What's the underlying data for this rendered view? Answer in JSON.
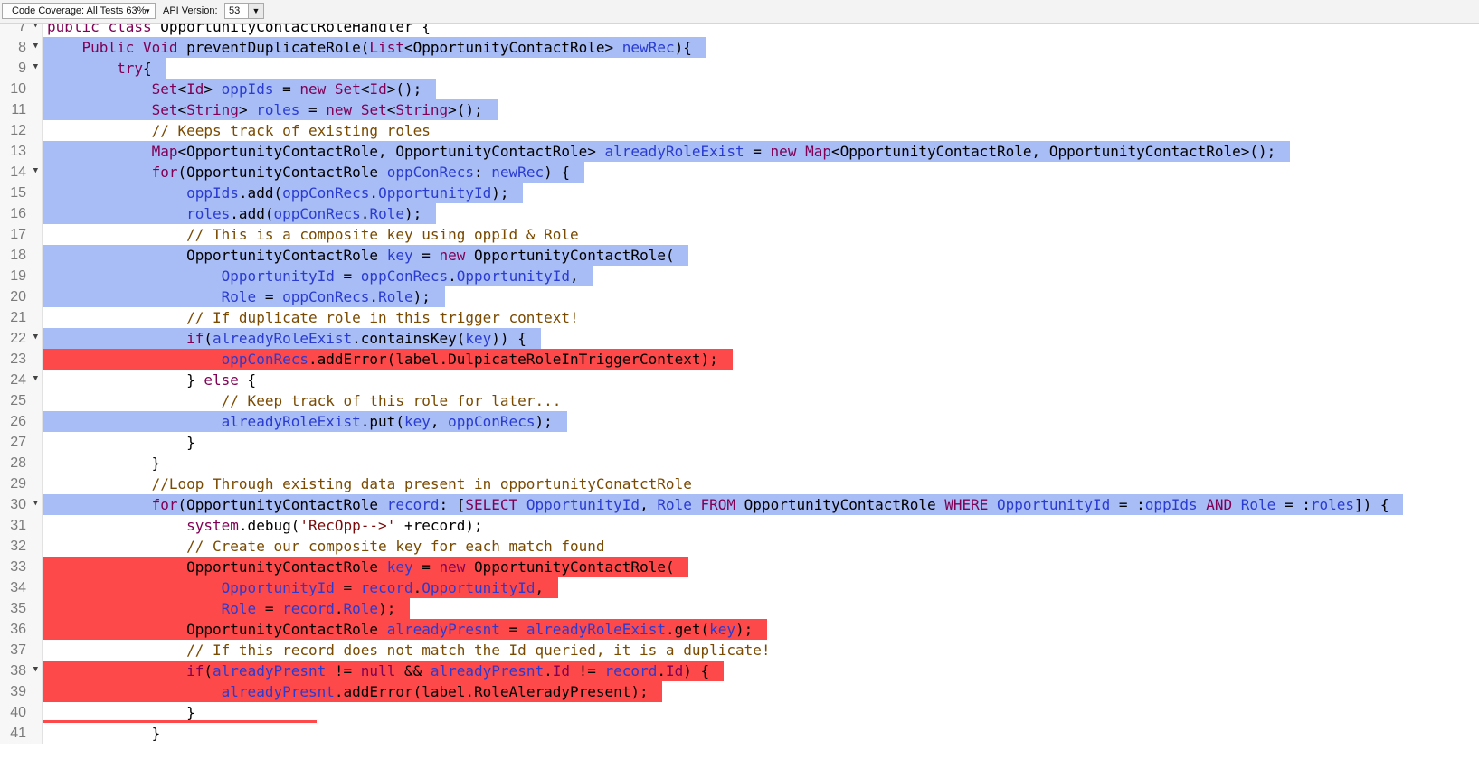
{
  "toolbar": {
    "coverage_label": "Code Coverage: All Tests 63%",
    "api_version_label": "API Version:",
    "api_version_value": "53"
  },
  "colors": {
    "covered": "#a8bcf5",
    "uncovered": "#fd4949"
  },
  "lines": [
    {
      "n": "7",
      "fold": true,
      "cov": "none",
      "text": "public class OpportunityContactRoleHandler {"
    },
    {
      "n": "8",
      "fold": true,
      "cov": "covered",
      "text": "    Public Void preventDuplicateRole(List<OpportunityContactRole> newRec){"
    },
    {
      "n": "9",
      "fold": true,
      "cov": "covered",
      "text": "        try{"
    },
    {
      "n": "10",
      "fold": false,
      "cov": "covered",
      "text": "            Set<Id> oppIds = new Set<Id>();"
    },
    {
      "n": "11",
      "fold": false,
      "cov": "covered",
      "text": "            Set<String> roles = new Set<String>();"
    },
    {
      "n": "12",
      "fold": false,
      "cov": "none",
      "text": "            // Keeps track of existing roles"
    },
    {
      "n": "13",
      "fold": false,
      "cov": "covered",
      "text": "            Map<OpportunityContactRole, OpportunityContactRole> alreadyRoleExist = new Map<OpportunityContactRole, OpportunityContactRole>();"
    },
    {
      "n": "14",
      "fold": true,
      "cov": "covered",
      "text": "            for(OpportunityContactRole oppConRecs: newRec) {"
    },
    {
      "n": "15",
      "fold": false,
      "cov": "covered",
      "text": "                oppIds.add(oppConRecs.OpportunityId);"
    },
    {
      "n": "16",
      "fold": false,
      "cov": "covered",
      "text": "                roles.add(oppConRecs.Role);"
    },
    {
      "n": "17",
      "fold": false,
      "cov": "none",
      "text": "                // This is a composite key using oppId & Role"
    },
    {
      "n": "18",
      "fold": false,
      "cov": "covered",
      "text": "                OpportunityContactRole key = new OpportunityContactRole("
    },
    {
      "n": "19",
      "fold": false,
      "cov": "covered",
      "text": "                    OpportunityId = oppConRecs.OpportunityId,"
    },
    {
      "n": "20",
      "fold": false,
      "cov": "covered",
      "text": "                    Role = oppConRecs.Role);"
    },
    {
      "n": "21",
      "fold": false,
      "cov": "none",
      "text": "                // If duplicate role in this trigger context!"
    },
    {
      "n": "22",
      "fold": true,
      "cov": "covered",
      "text": "                if(alreadyRoleExist.containsKey(key)) {"
    },
    {
      "n": "23",
      "fold": false,
      "cov": "uncovered",
      "text": "                    oppConRecs.addError(label.DulpicateRoleInTriggerContext);"
    },
    {
      "n": "24",
      "fold": true,
      "cov": "none",
      "text": "                } else {"
    },
    {
      "n": "25",
      "fold": false,
      "cov": "none",
      "text": "                    // Keep track of this role for later..."
    },
    {
      "n": "26",
      "fold": false,
      "cov": "covered",
      "text": "                    alreadyRoleExist.put(key, oppConRecs);"
    },
    {
      "n": "27",
      "fold": false,
      "cov": "none",
      "text": "                }"
    },
    {
      "n": "28",
      "fold": false,
      "cov": "none",
      "text": "            }"
    },
    {
      "n": "29",
      "fold": false,
      "cov": "none",
      "text": "            //Loop Through existing data present in opportunityConatctRole"
    },
    {
      "n": "30",
      "fold": true,
      "cov": "covered",
      "text": "            for(OpportunityContactRole record: [SELECT OpportunityId, Role FROM OpportunityContactRole WHERE OpportunityId = :oppIds AND Role = :roles]) {"
    },
    {
      "n": "31",
      "fold": false,
      "cov": "none",
      "text": "                system.debug('RecOpp-->' +record);"
    },
    {
      "n": "32",
      "fold": false,
      "cov": "none",
      "text": "                // Create our composite key for each match found"
    },
    {
      "n": "33",
      "fold": false,
      "cov": "uncovered",
      "text": "                OpportunityContactRole key = new OpportunityContactRole("
    },
    {
      "n": "34",
      "fold": false,
      "cov": "uncovered",
      "text": "                    OpportunityId = record.OpportunityId,"
    },
    {
      "n": "35",
      "fold": false,
      "cov": "uncovered",
      "text": "                    Role = record.Role);"
    },
    {
      "n": "36",
      "fold": false,
      "cov": "uncovered",
      "text": "                OpportunityContactRole alreadyPresnt = alreadyRoleExist.get(key);"
    },
    {
      "n": "37",
      "fold": false,
      "cov": "none",
      "text": "                // If this record does not match the Id queried, it is a duplicate!"
    },
    {
      "n": "38",
      "fold": true,
      "cov": "uncovered",
      "text": "                if(alreadyPresnt != null && alreadyPresnt.Id != record.Id) {"
    },
    {
      "n": "39",
      "fold": false,
      "cov": "uncovered",
      "text": "                    alreadyPresnt.addError(label.RoleAleradyPresent);"
    },
    {
      "n": "40",
      "fold": false,
      "cov": "none",
      "text": "                }"
    },
    {
      "n": "41",
      "fold": false,
      "cov": "none",
      "text": "            }"
    }
  ]
}
